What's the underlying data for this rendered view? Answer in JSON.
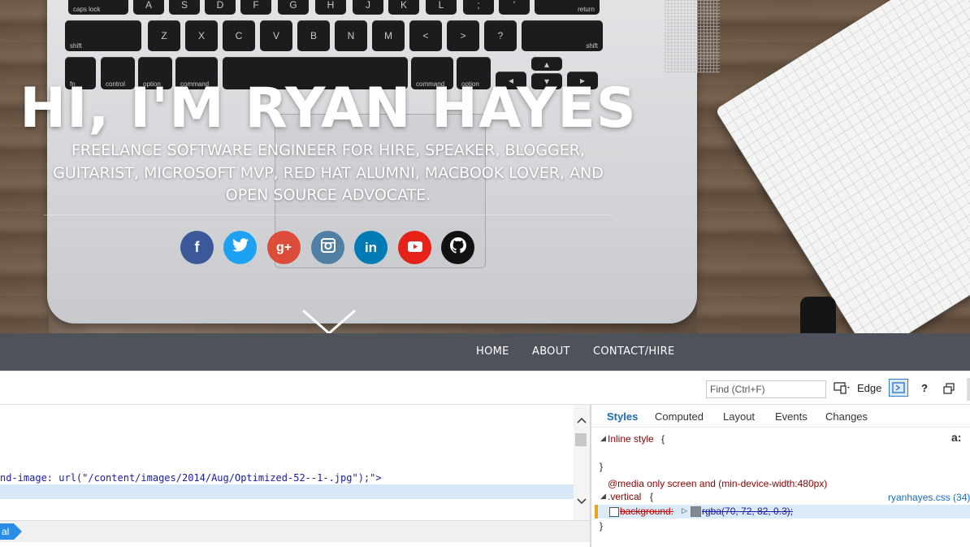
{
  "hero": {
    "title": "HI, I'M RYAN HAYES",
    "subtitle": "FREELANCE SOFTWARE ENGINEER FOR HIRE, SPEAKER, BLOGGER, GUITARIST, MICROSOFT MVP, RED HAT ALUMNI, MACBOOK LOVER, AND OPEN SOURCE ADVOCATE.",
    "keyboard_keys": [
      "caps lock",
      "A",
      "S",
      "D",
      "F",
      "G",
      "H",
      "J",
      "K",
      "L",
      ";",
      "'",
      "return",
      "shift",
      "Z",
      "X",
      "C",
      "V",
      "B",
      "N",
      "M",
      "<",
      ">",
      "?",
      "shift",
      "fn",
      "control",
      "option",
      "command",
      "command",
      "option"
    ],
    "social": [
      {
        "name": "facebook",
        "glyph": "f",
        "color": "#3b5998"
      },
      {
        "name": "twitter",
        "glyph": "t",
        "color": "#1da1f2"
      },
      {
        "name": "google-plus",
        "glyph": "g+",
        "color": "#dd4b39"
      },
      {
        "name": "instagram",
        "glyph": "◉",
        "color": "#517fa4"
      },
      {
        "name": "linkedin",
        "glyph": "in",
        "color": "#007bb6"
      },
      {
        "name": "youtube",
        "glyph": "▶",
        "color": "#e62117"
      },
      {
        "name": "github",
        "glyph": "◐",
        "color": "#111111"
      }
    ]
  },
  "nav": {
    "items": [
      "HOME",
      "ABOUT",
      "CONTACT/HIRE"
    ]
  },
  "devtools": {
    "find_placeholder": "Find (Ctrl+F)",
    "browser_mode": "Edge",
    "help": "?",
    "dom_lines": [
      "nd-image: url(\"/content/images/2014/Aug/Optimized-52--1-.jpg\");\">"
    ],
    "breadcrumb": "al",
    "style_tabs": [
      "Styles",
      "Computed",
      "Layout",
      "Events",
      "Changes"
    ],
    "active_tab": "Styles",
    "inline_style_label": "Inline style",
    "open_brace": "{",
    "close_brace": "}",
    "media_query": "@media only screen and (min-device-width:480px)",
    "selector": ".vertical",
    "source_file": "ryanhayes.css (34)",
    "property_name": "background:",
    "property_value": "rgba(70, 72, 82, 0.3);",
    "swatch_color": "#464852",
    "colors": {
      "accent": "#1c6bb7",
      "nav_bg": "#4f515b",
      "highlight_row": "#dbeaf7",
      "selected_line": "#d6e8f8"
    }
  }
}
